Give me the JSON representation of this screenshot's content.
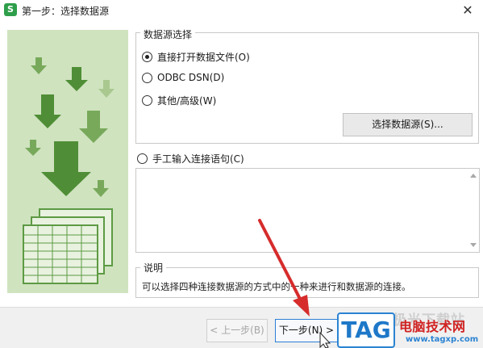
{
  "window": {
    "app_icon": "S",
    "title": "第一步：选择数据源",
    "close_glyph": "✕"
  },
  "data_source_section": {
    "legend": "数据源选择",
    "options": [
      {
        "label": "直接打开数据文件(O)",
        "checked": true
      },
      {
        "label": "ODBC DSN(D)",
        "checked": false
      },
      {
        "label": "其他/高级(W)",
        "checked": false
      }
    ],
    "select_button": "选择数据源(S)..."
  },
  "manual_input": {
    "label": "手工输入连接语句(C)",
    "checked": false,
    "value": ""
  },
  "description": {
    "legend": "说明",
    "text": "可以选择四种连接数据源的方式中的一种来进行和数据源的连接。"
  },
  "footer": {
    "prev_button": "< 上一步(B)",
    "next_button": "下一步(N) >"
  },
  "watermark": {
    "faded_text": "极光下载站",
    "logo_text": "TAG",
    "site_title": "电脑技术网",
    "site_url": "www.tagxp.com"
  },
  "colors": {
    "illustration_bg": "#cfe3bf",
    "arrow_dark": "#4f8e36",
    "arrow_mid": "#78a95b",
    "arrow_light": "#a9c88f",
    "annotation_arrow": "#d62c2c",
    "primary_border": "#2c7fd6"
  },
  "icons": [
    "close-icon",
    "download-arrow-icon",
    "spreadsheet-icon",
    "cursor-icon",
    "red-arrow-annotation"
  ]
}
